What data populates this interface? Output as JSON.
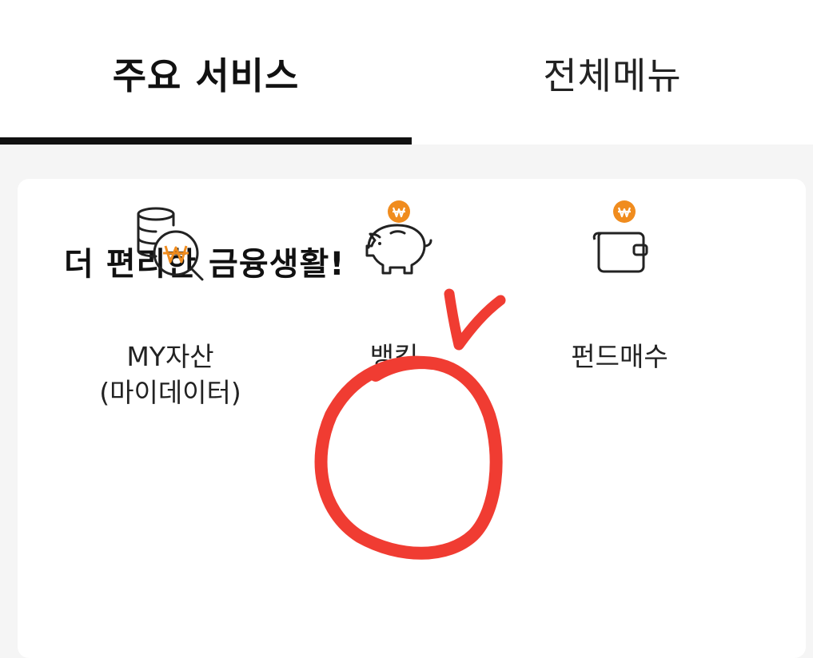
{
  "tabs": {
    "main_label": "주요 서비스",
    "all_label": "전체메뉴"
  },
  "card": {
    "title": "더 편리한 금융생활!",
    "services": [
      {
        "label_line1": "MY자산",
        "label_line2": "(마이데이터)",
        "icon": "database-won-search-icon"
      },
      {
        "label_line1": "뱅킹",
        "label_line2": "",
        "icon": "piggy-bank-icon"
      },
      {
        "label_line1": "펀드매수",
        "label_line2": "",
        "icon": "wallet-icon"
      }
    ]
  },
  "colors": {
    "accent_orange": "#f08c1e",
    "annotation_red": "#f03c32",
    "tab_underline": "#111111",
    "background": "#f5f5f5"
  }
}
